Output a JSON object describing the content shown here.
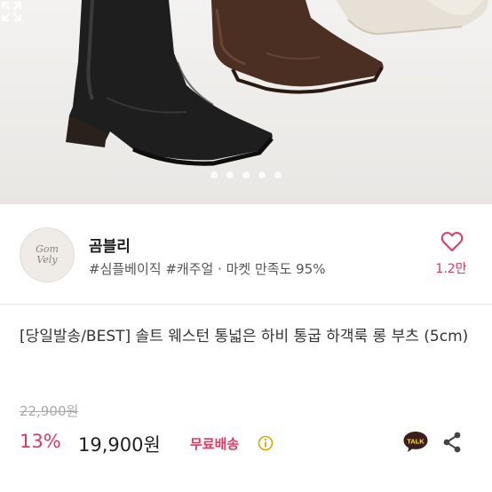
{
  "gallery": {
    "dots": [
      false,
      false,
      false,
      true,
      false
    ],
    "expand_icon": "expand-icon"
  },
  "shop": {
    "logo_line1": "Gom",
    "logo_line2": "Vely",
    "name": "곰블리",
    "tags": "#심플베이직 #캐주얼 · 마켓 만족도 95%",
    "like_icon": "heart-icon",
    "like_count": "1.2만"
  },
  "product": {
    "title": "[당일발송/BEST] 솔트 웨스턴 통넓은 하비 통굽 하객룩 롱 부츠 (5cm)",
    "original_price": "22,900원",
    "discount": "13%",
    "price": "19,900원",
    "shipping": "무료배송",
    "talk_label": "TALK"
  },
  "colors": {
    "accent": "#e5375f"
  }
}
